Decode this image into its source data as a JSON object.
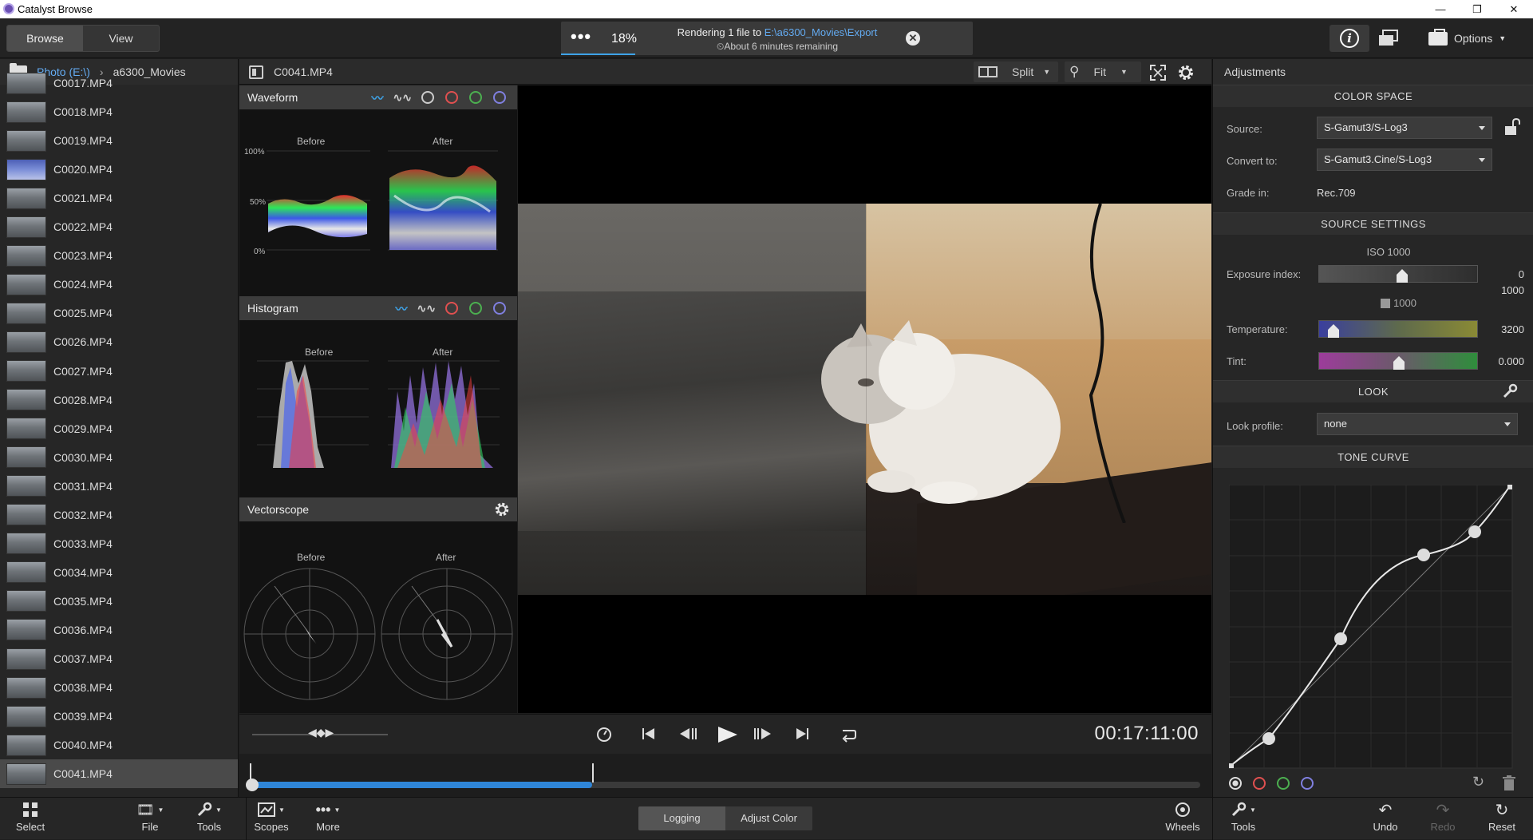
{
  "app": {
    "title": "Catalyst Browse"
  },
  "window_controls": {
    "minimize": "—",
    "maximize": "❐",
    "close": "✕"
  },
  "topbar": {
    "tabs": [
      {
        "label": "Browse",
        "active": true
      },
      {
        "label": "View",
        "active": false
      }
    ],
    "render": {
      "dots": "•••",
      "percent": "18%",
      "progress": 0.18,
      "line1_prefix": "Rendering 1 file to ",
      "line1_link": "E:\\a6300_Movies\\Export",
      "line2": "About 6 minutes remaining",
      "close": "✕"
    },
    "info": "i",
    "options_label": "Options"
  },
  "browser": {
    "breadcrumb": [
      "Photo (E:\\)",
      "a6300_Movies"
    ],
    "files": [
      "C0017.MP4",
      "C0018.MP4",
      "C0019.MP4",
      "C0020.MP4",
      "C0021.MP4",
      "C0022.MP4",
      "C0023.MP4",
      "C0024.MP4",
      "C0025.MP4",
      "C0026.MP4",
      "C0027.MP4",
      "C0028.MP4",
      "C0029.MP4",
      "C0030.MP4",
      "C0031.MP4",
      "C0032.MP4",
      "C0033.MP4",
      "C0034.MP4",
      "C0035.MP4",
      "C0036.MP4",
      "C0037.MP4",
      "C0038.MP4",
      "C0039.MP4",
      "C0040.MP4",
      "C0041.MP4"
    ],
    "selected": "C0041.MP4"
  },
  "viewer": {
    "filename": "C0041.MP4",
    "split_label": "Split",
    "zoom_label": "Fit",
    "timecode": "00:17:11:00",
    "timeline_progress": 0.36
  },
  "scopes": {
    "waveform": {
      "title": "Waveform",
      "before": "Before",
      "after": "After",
      "y_labels": [
        "100%",
        "50%",
        "0%"
      ]
    },
    "histogram": {
      "title": "Histogram",
      "before": "Before",
      "after": "After"
    },
    "vectorscope": {
      "title": "Vectorscope",
      "before": "Before",
      "after": "After"
    }
  },
  "adjustments": {
    "title": "Adjustments",
    "color_space": {
      "header": "COLOR SPACE",
      "source_label": "Source:",
      "source_value": "S-Gamut3/S-Log3",
      "convert_label": "Convert to:",
      "convert_value": "S-Gamut3.Cine/S-Log3",
      "grade_label": "Grade in:",
      "grade_value": "Rec.709"
    },
    "source_settings": {
      "header": "SOURCE SETTINGS",
      "iso": "ISO 1000",
      "exposure_label": "Exposure index:",
      "exposure_value": "0",
      "exposure_value2": "1000",
      "exposure_sub": "1000",
      "exposure_level": 0.52,
      "temperature_label": "Temperature:",
      "temperature_value": "3200",
      "temperature_level": 0.09,
      "tint_label": "Tint:",
      "tint_value": "0.000",
      "tint_level": 0.5
    },
    "look": {
      "header": "LOOK",
      "profile_label": "Look profile:",
      "profile_value": "none"
    },
    "tone_curve": {
      "header": "TONE CURVE"
    }
  },
  "bottombar": {
    "select": "Select",
    "file": "File",
    "tools": "Tools",
    "scopes": "Scopes",
    "more": "More",
    "mode_tabs": [
      {
        "label": "Logging",
        "active": true
      },
      {
        "label": "Adjust Color",
        "active": false
      }
    ],
    "wheels": "Wheels",
    "tools_right": "Tools",
    "undo": "Undo",
    "redo": "Redo",
    "reset": "Reset"
  },
  "colors": {
    "accent": "#3ea3e8",
    "link": "#63aaf0"
  }
}
